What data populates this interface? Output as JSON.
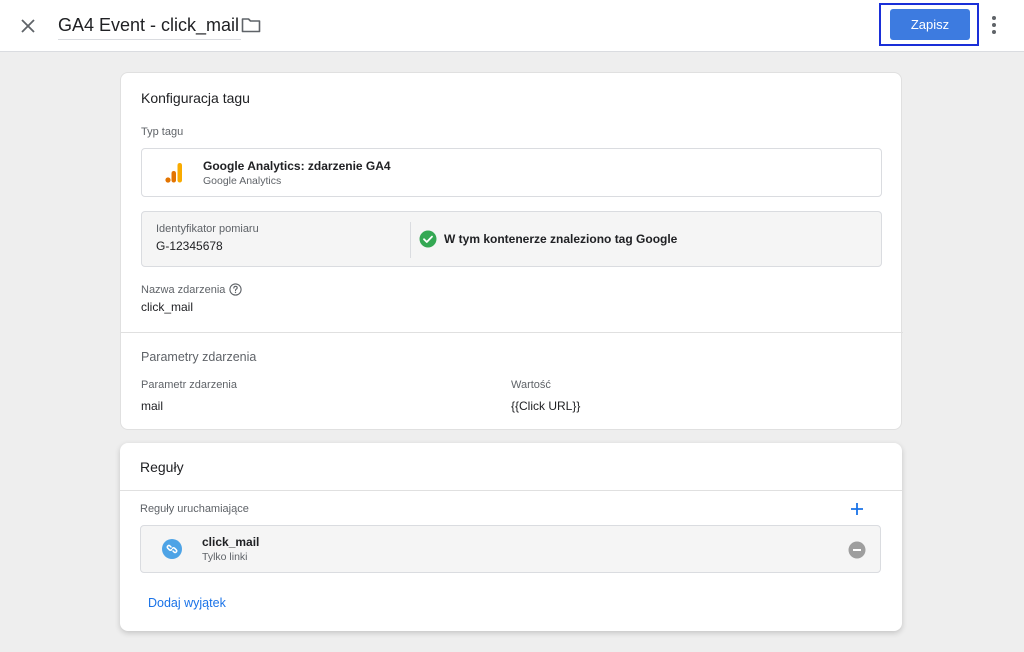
{
  "header": {
    "title": "GA4 Event - click_mail",
    "save_label": "Zapisz"
  },
  "config": {
    "title": "Konfiguracja tagu",
    "tag_type_label": "Typ tagu",
    "tag_type_name": "Google Analytics: zdarzenie GA4",
    "tag_type_sub": "Google Analytics",
    "measurement_label": "Identyfikator pomiaru",
    "measurement_value": "G-12345678",
    "found_text": "W tym kontenerze znaleziono tag Google",
    "event_name_label": "Nazwa zdarzenia",
    "event_name_value": "click_mail",
    "params_title": "Parametry zdarzenia",
    "params_header_name": "Parametr zdarzenia",
    "params_header_value": "Wartość",
    "params": [
      {
        "name": "mail",
        "value": "{{Click URL}}"
      }
    ]
  },
  "rules": {
    "title": "Reguły",
    "firing_label": "Reguły uruchamiające",
    "items": [
      {
        "name": "click_mail",
        "type": "Tylko linki"
      }
    ],
    "add_exception": "Dodaj wyjątek"
  },
  "colors": {
    "accent": "#3d7be0",
    "link": "#1a73e8",
    "success": "#34a853",
    "highlight_outline": "#1a2fd8",
    "trigger_icon": "#4da3e6"
  },
  "icons": {
    "close": "close-icon",
    "folder": "folder-icon",
    "more": "more-vert-icon",
    "analytics": "google-analytics-icon",
    "help": "help-icon",
    "check": "check-circle-icon",
    "add": "add-icon",
    "link": "link-icon",
    "remove": "remove-circle-icon"
  }
}
